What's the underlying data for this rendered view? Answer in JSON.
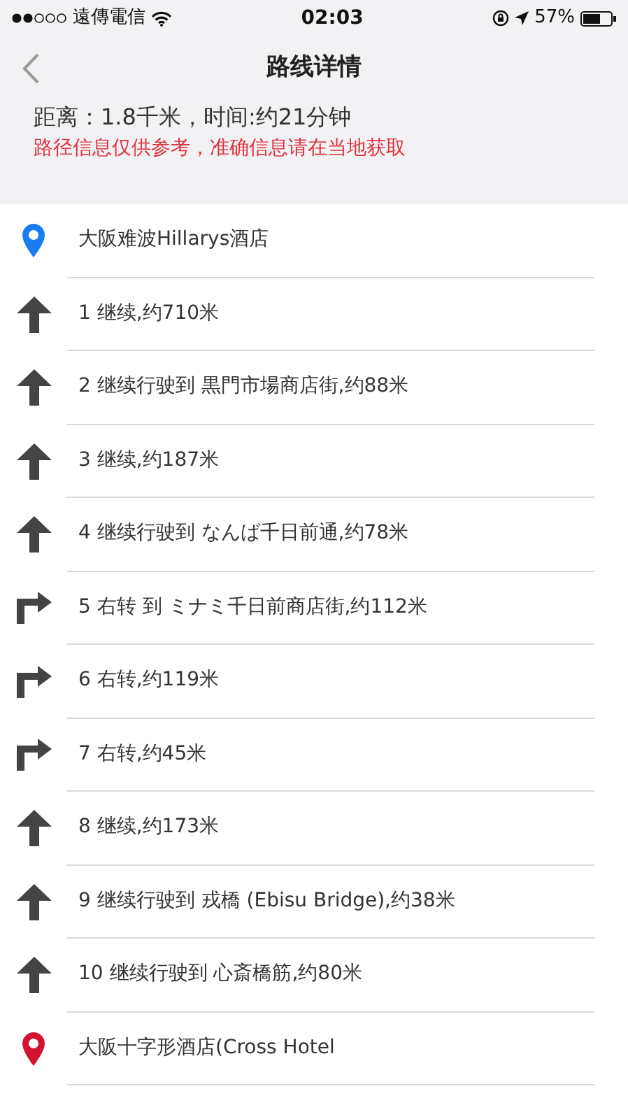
{
  "status_bar": {
    "carrier": "遠傳電信",
    "time": "02:03",
    "battery": "57%"
  },
  "nav": {
    "title": "路线详情"
  },
  "summary": {
    "distance": "距离：1.8千米，时间:约21分钟",
    "notice": "路径信息仅供参考，准确信息请在当地获取"
  },
  "steps": [
    {
      "kind": "start",
      "text": "大阪难波Hillarys酒店"
    },
    {
      "kind": "straight",
      "text": "1 继续,约710米"
    },
    {
      "kind": "straight",
      "text": "2 继续行驶到 黒門市場商店街,约88米"
    },
    {
      "kind": "straight",
      "text": "3 继续,约187米"
    },
    {
      "kind": "straight",
      "text": "4 继续行驶到 なんば千日前通,约78米"
    },
    {
      "kind": "right",
      "text": "5 右转 到  ミナミ千日前商店街,约112米"
    },
    {
      "kind": "right",
      "text": "6 右转,约119米"
    },
    {
      "kind": "right",
      "text": "7 右转,约45米"
    },
    {
      "kind": "straight",
      "text": "8 继续,约173米"
    },
    {
      "kind": "straight",
      "text": "9 继续行驶到 戎橋 (Ebisu Bridge),约38米"
    },
    {
      "kind": "straight",
      "text": "10 继续行驶到 心斎橋筋,约80米"
    },
    {
      "kind": "end",
      "text": "大阪十字形酒店(Cross Hotel"
    }
  ]
}
